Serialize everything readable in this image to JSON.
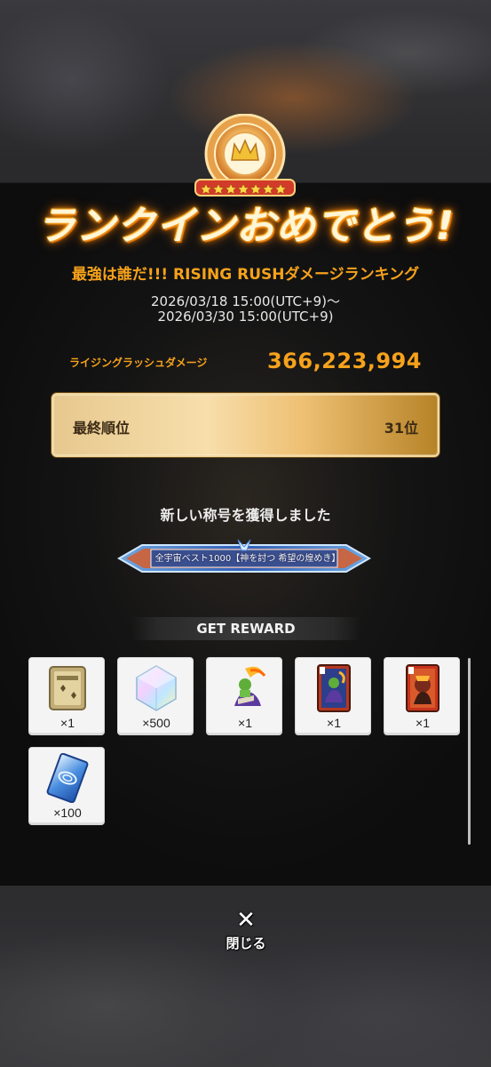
{
  "banner": {
    "title": "ランクインおめでとう!"
  },
  "event": {
    "title": "最強は誰だ!!! RISING RUSHダメージランキング",
    "period_start": "2026/03/18 15:00(UTC+9)～",
    "period_end": "2026/03/30 15:00(UTC+9)"
  },
  "damage": {
    "label": "ライジングラッシュダメージ",
    "value": "366,223,994"
  },
  "rank": {
    "label": "最終順位",
    "value": "31位"
  },
  "new_title": {
    "message": "新しい称号を獲得しました",
    "plate_text": "全宇宙ベスト1000【神を討つ 希望の煌めき】"
  },
  "rewards": {
    "header": "GET REWARD",
    "items": [
      {
        "icon": "ticket-icon",
        "qty": "×1"
      },
      {
        "icon": "crystal-icon",
        "qty": "×500"
      },
      {
        "icon": "character-art-icon",
        "qty": "×1"
      },
      {
        "icon": "character-card-icon",
        "qty": "×1"
      },
      {
        "icon": "character-card-icon-2",
        "qty": "×1"
      },
      {
        "icon": "ticket-blue-icon",
        "qty": "×100"
      }
    ]
  },
  "close": {
    "symbol": "✕",
    "label": "閉じる"
  },
  "colors": {
    "accent": "#f6a21b",
    "panel": "#141414",
    "gold": "#eec073"
  }
}
